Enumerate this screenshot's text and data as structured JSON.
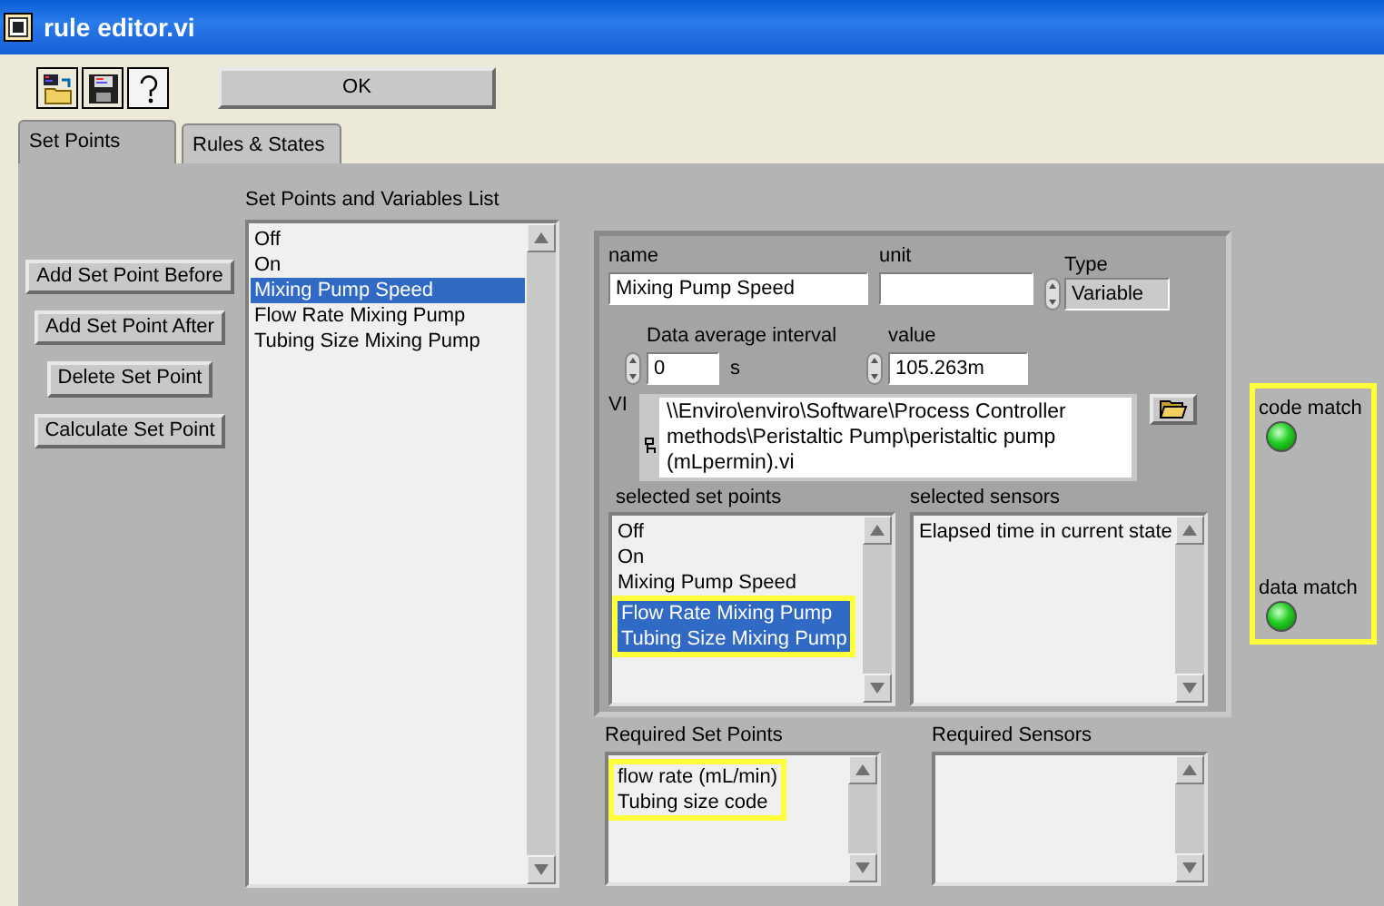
{
  "window": {
    "title": "rule editor.vi"
  },
  "toolbar": {
    "ok_button": "OK"
  },
  "tabs": [
    {
      "label": "Set Points",
      "selected": true
    },
    {
      "label": "Rules & States",
      "selected": false
    }
  ],
  "actions": [
    "Add Set Point Before",
    "Add Set Point After",
    "Delete Set Point",
    "Calculate Set Point"
  ],
  "set_points_list": {
    "label": "Set Points and Variables List",
    "items": [
      {
        "text": "Off",
        "selected": false
      },
      {
        "text": "On",
        "selected": false
      },
      {
        "text": "Mixing Pump Speed",
        "selected": true
      },
      {
        "text": "Flow Rate Mixing Pump",
        "selected": false
      },
      {
        "text": "Tubing Size Mixing Pump",
        "selected": false
      }
    ]
  },
  "details": {
    "name": {
      "label": "name",
      "value": "Mixing Pump Speed"
    },
    "unit": {
      "label": "unit"
    },
    "type": {
      "label": "Type",
      "value": "Variable"
    },
    "interval": {
      "label": "Data average interval",
      "value": "0",
      "suffix": "s"
    },
    "value": {
      "label": "value",
      "value": "105.263m"
    },
    "vi": {
      "label": "VI",
      "path": "\\\\Enviro\\enviro\\Software\\Process Controller methods\\Peristaltic Pump\\peristaltic pump (mLpermin).vi"
    },
    "selected_set_points": {
      "label": "selected set points",
      "items": [
        {
          "text": "Off",
          "selected": false,
          "highlighted": false
        },
        {
          "text": "On",
          "selected": false,
          "highlighted": false
        },
        {
          "text": "Mixing Pump Speed",
          "selected": false,
          "highlighted": false
        },
        {
          "text": "Flow Rate Mixing Pump",
          "selected": true,
          "highlighted": true
        },
        {
          "text": "Tubing Size Mixing Pump",
          "selected": true,
          "highlighted": true
        }
      ]
    },
    "selected_sensors": {
      "label": "selected sensors",
      "items": [
        {
          "text": "Elapsed time in current state",
          "selected": false,
          "highlighted": false
        }
      ]
    }
  },
  "required_set_points": {
    "label": "Required Set Points",
    "items": [
      {
        "text": "flow rate (mL/min)",
        "selected": false,
        "highlighted": true
      },
      {
        "text": "Tubing size code",
        "selected": false,
        "highlighted": true
      }
    ]
  },
  "required_sensors": {
    "label": "Required Sensors"
  },
  "indicators": {
    "highlighted": true,
    "leds": [
      {
        "label": "code match",
        "on": true
      },
      {
        "label": "data match",
        "on": true
      }
    ]
  }
}
